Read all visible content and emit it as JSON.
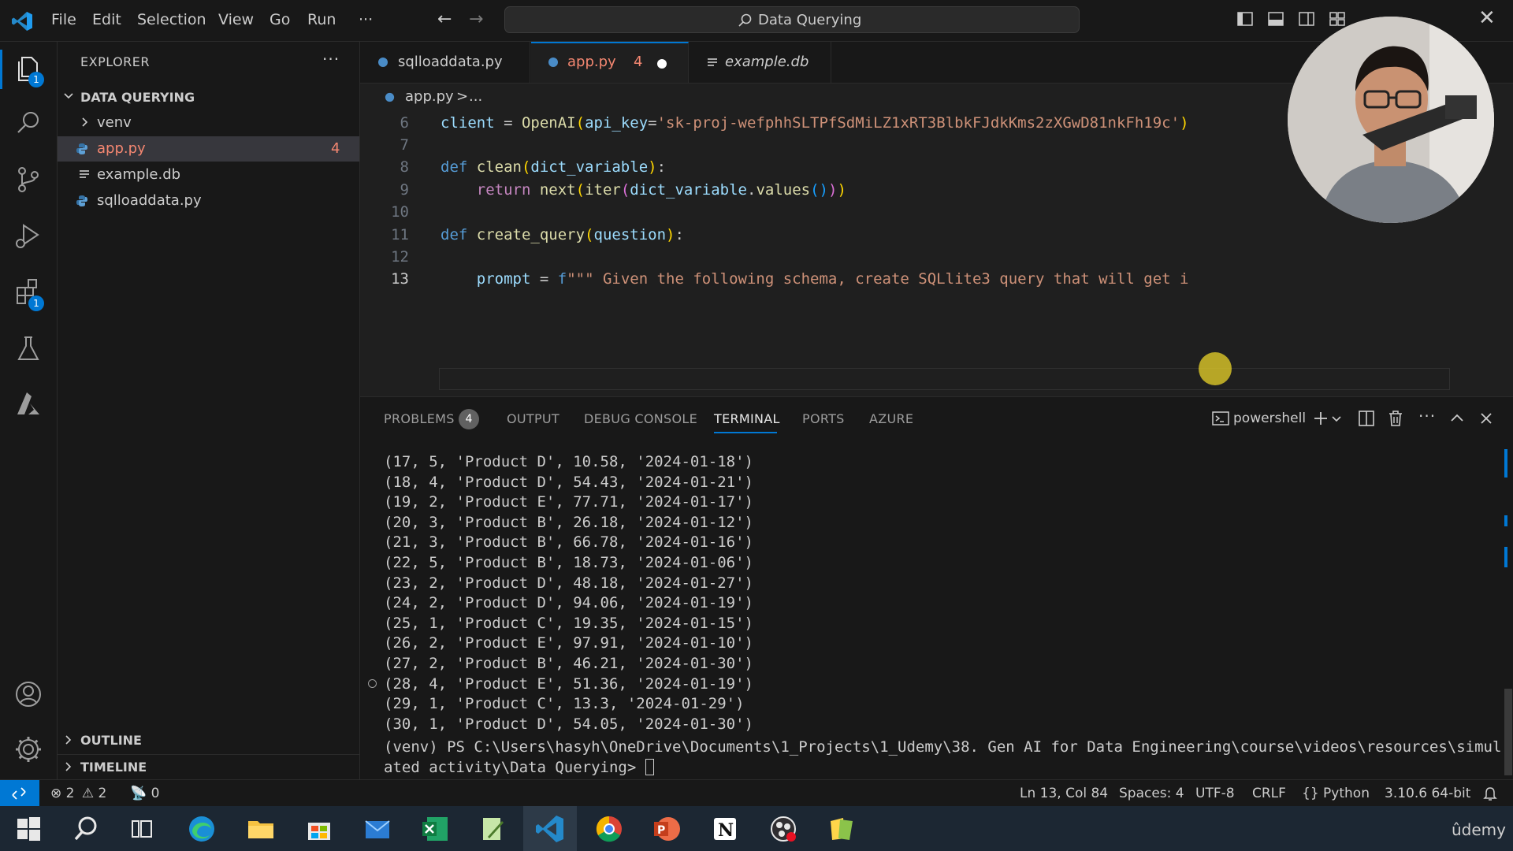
{
  "titlebar": {
    "menu": [
      "File",
      "Edit",
      "Selection",
      "View",
      "Go",
      "Run",
      "···"
    ],
    "search_text": "Data Querying"
  },
  "activity_bar": {
    "explorer_badge": "1",
    "extensions_badge": "1"
  },
  "sidebar": {
    "title": "EXPLORER",
    "more": "···",
    "folder": "DATA QUERYING",
    "items": [
      {
        "label": "venv",
        "kind": "folder"
      },
      {
        "label": "app.py",
        "kind": "python",
        "problems": "4",
        "selected": true
      },
      {
        "label": "example.db",
        "kind": "database"
      },
      {
        "label": "sqlloaddata.py",
        "kind": "python"
      }
    ],
    "outline": "OUTLINE",
    "timeline": "TIMELINE"
  },
  "tabs": [
    {
      "label": "sqlloaddata.py"
    },
    {
      "label": "app.py",
      "problems": "4",
      "dirty": true,
      "active": true
    },
    {
      "label": "example.db",
      "italic": true
    }
  ],
  "breadcrumb": {
    "file": "app.py",
    "sep": ">",
    "rest": "..."
  },
  "editor": {
    "lines": [
      {
        "n": "6",
        "tokens": [
          [
            "var",
            "client"
          ],
          [
            "pun",
            " = "
          ],
          [
            "fn",
            "OpenAI"
          ],
          [
            "par1",
            "("
          ],
          [
            "var",
            "api_key"
          ],
          [
            "pun",
            "="
          ],
          [
            "str",
            "'sk-proj-wefphhSLTPfSdMiLZ1xRT3BlbkFJdkKms2zXGwD81nkFh19c'"
          ],
          [
            "par1",
            ")"
          ]
        ]
      },
      {
        "n": "7",
        "tokens": []
      },
      {
        "n": "8",
        "tokens": [
          [
            "kw",
            "def "
          ],
          [
            "fn",
            "clean"
          ],
          [
            "par1",
            "("
          ],
          [
            "var",
            "dict_variable"
          ],
          [
            "par1",
            ")"
          ],
          [
            "pun",
            ":"
          ]
        ]
      },
      {
        "n": "9",
        "tokens": [
          [
            "pun",
            "    "
          ],
          [
            "kw2",
            "return "
          ],
          [
            "fn",
            "next"
          ],
          [
            "par1",
            "("
          ],
          [
            "fn",
            "iter"
          ],
          [
            "par2",
            "("
          ],
          [
            "var",
            "dict_variable"
          ],
          [
            "pun",
            "."
          ],
          [
            "fn",
            "values"
          ],
          [
            "par3",
            "()"
          ],
          [
            "par2",
            ")"
          ],
          [
            "par1",
            ")"
          ]
        ]
      },
      {
        "n": "10",
        "tokens": []
      },
      {
        "n": "11",
        "tokens": [
          [
            "kw",
            "def "
          ],
          [
            "fn",
            "create_query"
          ],
          [
            "par1",
            "("
          ],
          [
            "var",
            "question"
          ],
          [
            "par1",
            ")"
          ],
          [
            "pun",
            ":"
          ]
        ]
      },
      {
        "n": "12",
        "tokens": []
      },
      {
        "n": "13",
        "current": true,
        "tokens": [
          [
            "pun",
            "    "
          ],
          [
            "var",
            "prompt"
          ],
          [
            "pun",
            " = "
          ],
          [
            "kw",
            "f"
          ],
          [
            "str",
            "\"\"\" Given the following schema, create SQLlite3 query that will get i"
          ]
        ]
      }
    ]
  },
  "panel": {
    "tabs": [
      "PROBLEMS",
      "OUTPUT",
      "DEBUG CONSOLE",
      "TERMINAL",
      "PORTS",
      "AZURE"
    ],
    "problems_count": "4",
    "active_tab": "TERMINAL",
    "shell": "powershell",
    "terminal_lines": [
      "(17, 5, 'Product D', 10.58, '2024-01-18')",
      "(18, 4, 'Product D', 54.43, '2024-01-21')",
      "(19, 2, 'Product E', 77.71, '2024-01-17')",
      "(20, 3, 'Product B', 26.18, '2024-01-12')",
      "(21, 3, 'Product B', 66.78, '2024-01-16')",
      "(22, 5, 'Product B', 18.73, '2024-01-06')",
      "(23, 2, 'Product D', 48.18, '2024-01-27')",
      "(24, 2, 'Product D', 94.06, '2024-01-19')",
      "(25, 1, 'Product C', 19.35, '2024-01-15')",
      "(26, 2, 'Product E', 97.91, '2024-01-10')",
      "(27, 2, 'Product B', 46.21, '2024-01-30')",
      "(28, 4, 'Product E', 51.36, '2024-01-19')",
      "(29, 1, 'Product C', 13.3, '2024-01-29')",
      "(30, 1, 'Product D', 54.05, '2024-01-30')"
    ],
    "prompt_line1": "(venv) PS C:\\Users\\hasyh\\OneDrive\\Documents\\1_Projects\\1_Udemy\\38. Gen AI for Data Engineering\\course\\videos\\resources\\simul",
    "prompt_line2": "ated activity\\Data Querying> "
  },
  "statusbar": {
    "errors": "2",
    "warnings": "2",
    "ports": "0",
    "position": "Ln 13, Col 84",
    "spaces": "Spaces: 4",
    "encoding": "UTF-8",
    "eol": "CRLF",
    "language": "Python",
    "interpreter": "3.10.6 64-bit"
  },
  "taskbar": {
    "watermark": "ûdemy"
  },
  "colors": {
    "accent": "#0078d4",
    "editor_bg": "#1f1f1f",
    "chrome_bg": "#181818",
    "error_count": "#f14c4c"
  }
}
